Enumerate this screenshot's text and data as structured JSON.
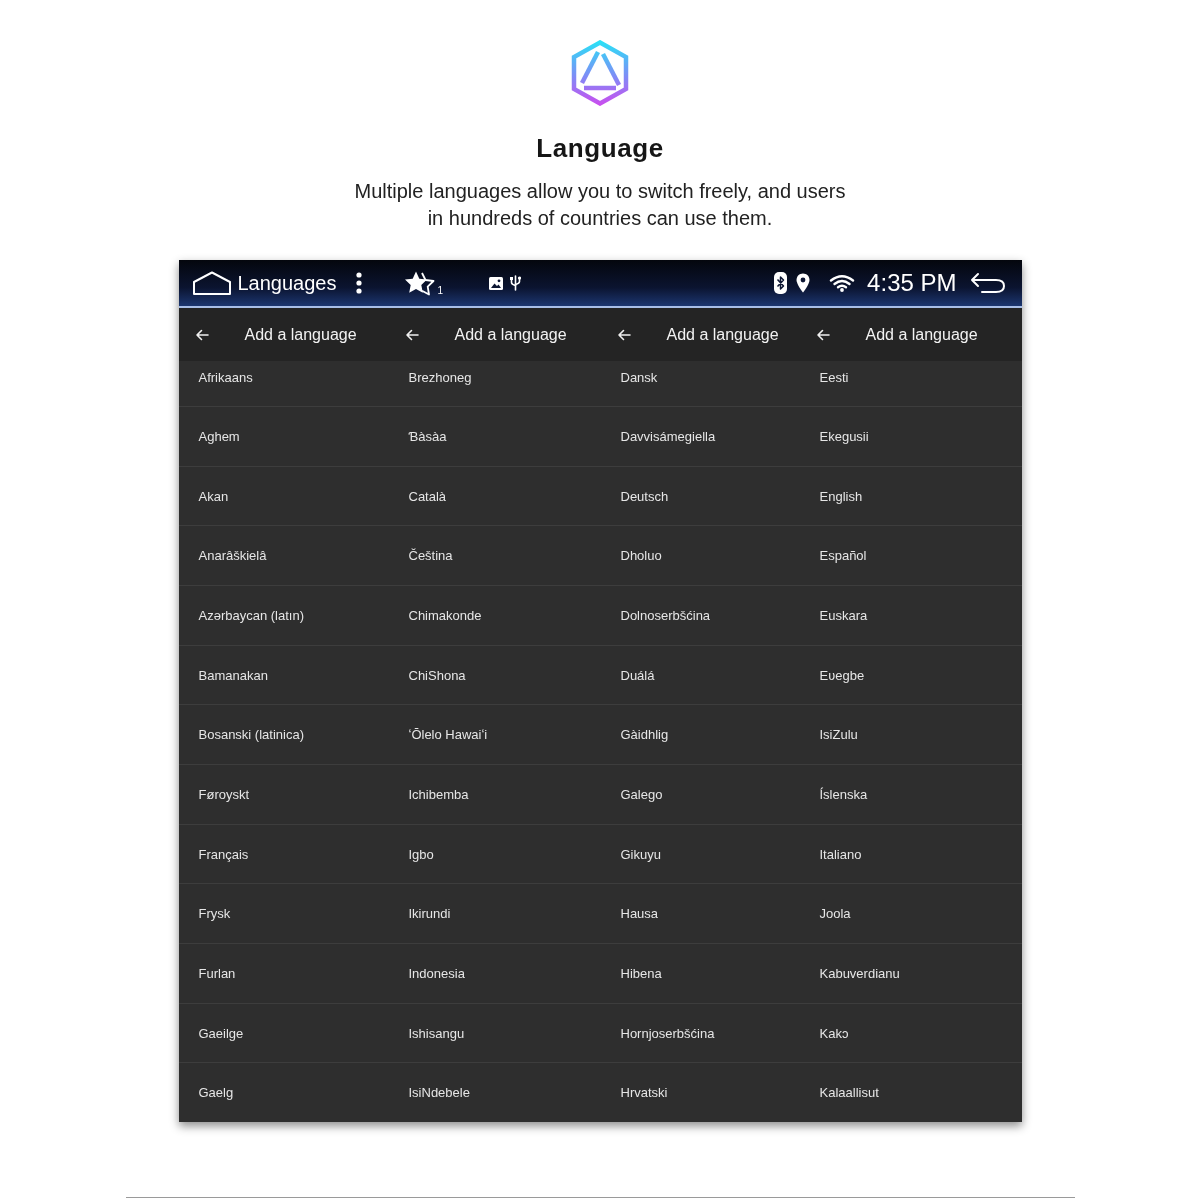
{
  "intro": {
    "title": "Language",
    "description_lines": [
      "Multiple languages allow you to switch freely, and users",
      "in hundreds of countries can use them."
    ]
  },
  "status_bar": {
    "title": "Languages",
    "star_count": "1",
    "time": "4:35 PM"
  },
  "panels": [
    {
      "title": "Add a language",
      "items": [
        "Afrikaans",
        "Aghem",
        "Akan",
        "Anarâškielâ",
        "Azərbaycan (latın)",
        "Bamanakan",
        "Bosanski (latinica)",
        "Føroyskt",
        "Français",
        "Frysk",
        "Furlan",
        "Gaeilge",
        "Gaelg"
      ]
    },
    {
      "title": "Add a language",
      "items": [
        "Brezhoneg",
        "Ɓàsàa",
        "Català",
        "Čeština",
        "Chimakonde",
        "ChiShona",
        "ʻŌlelo Hawaiʻi",
        "Ichibemba",
        "Igbo",
        "Ikirundi",
        "Indonesia",
        "Ishisangu",
        "IsiNdebele"
      ]
    },
    {
      "title": "Add a language",
      "items": [
        "Dansk",
        "Davvisámegiella",
        "Deutsch",
        "Dholuo",
        "Dolnoserbšćina",
        "Duálá",
        "Gàidhlig",
        "Galego",
        "Gikuyu",
        "Hausa",
        "Hibena",
        "Hornjoserbšćina",
        "Hrvatski"
      ]
    },
    {
      "title": "Add a language",
      "items": [
        "Eesti",
        "Ekegusii",
        "English",
        "Español",
        "Euskara",
        "Eʋegbe",
        "IsiZulu",
        "Íslenska",
        "Italiano",
        "Joola",
        "Kabuverdianu",
        "Kakɔ",
        "Kalaallisut"
      ]
    }
  ]
}
